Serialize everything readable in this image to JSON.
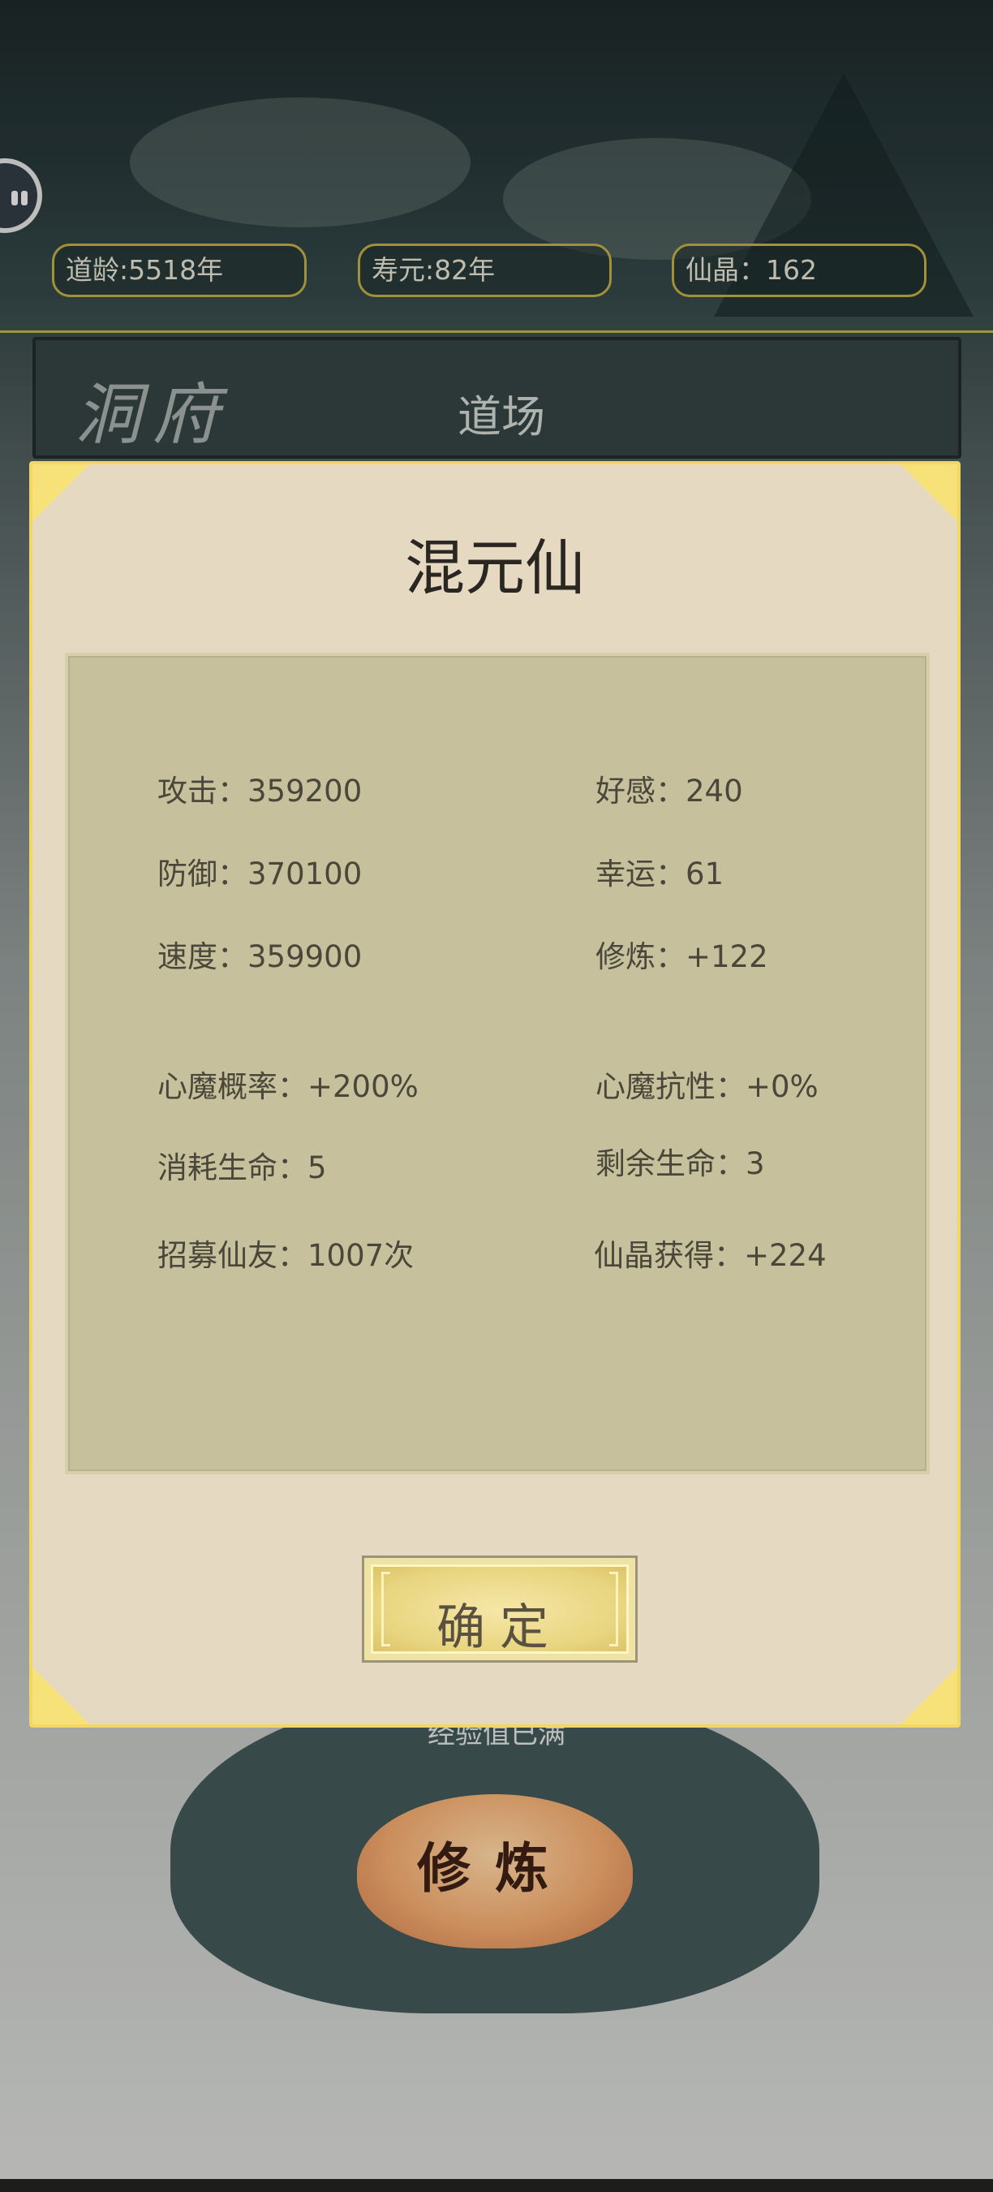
{
  "header": {
    "dao_age": "道龄:5518年",
    "lifespan": "寿元:82年",
    "crystals": "仙晶：162"
  },
  "tabs": {
    "cave_title": "洞府",
    "daochang": "道场"
  },
  "background": {
    "partial_caption": "经验值已满",
    "cultivate_label": "修炼"
  },
  "modal": {
    "title": "混元仙",
    "stats": {
      "attack": "攻击：359200",
      "favor": "好感：240",
      "defense": "防御：370100",
      "luck": "幸运：61",
      "speed": "速度：359900",
      "cultivation": "修炼：+122",
      "demon_chance": "心魔概率：+200%",
      "demon_resist": "心魔抗性：+0%",
      "life_cost": "消耗生命：5",
      "life_left": "剩余生命：3",
      "recruit": "招募仙友：1007次",
      "crystal_gain": "仙晶获得：+224"
    },
    "confirm_label": "确定"
  },
  "colors": {
    "modal_bg": "#e5d9c2",
    "panel_bg": "#c6c09d",
    "gold_border": "#f2d765",
    "pill_border": "#b8a541"
  }
}
